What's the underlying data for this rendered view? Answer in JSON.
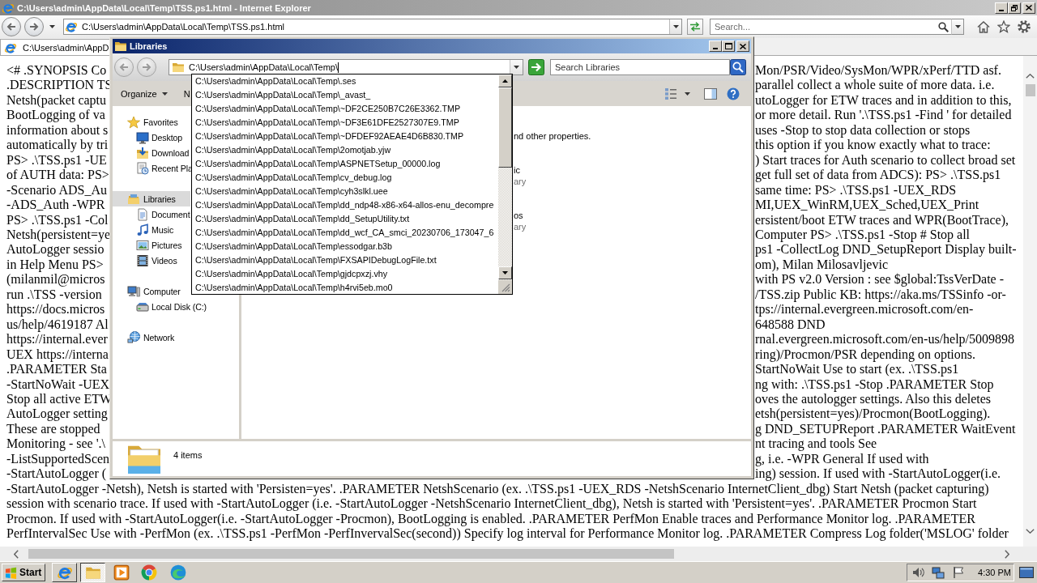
{
  "browser": {
    "title": "C:\\Users\\admin\\AppData\\Local\\Temp\\TSS.ps1.html - Internet Explorer",
    "address": "C:\\Users\\admin\\AppData\\Local\\Temp\\TSS.ps1.html",
    "search": {
      "placeholder": "Search..."
    },
    "tabs": [
      {
        "label": "C:\\Users\\admin\\AppD",
        "selected": true
      }
    ]
  },
  "document": {
    "split_lines": [
      {
        "left": "<# .SYNOPSIS Co",
        "right": "Mon/PSR/Video/SysMon/WPR/xPerf/TTD asf."
      },
      {
        "left": ".DESCRIPTION TS",
        "right": "parallel collect a whole suite of more data. i.e."
      },
      {
        "left": "Netsh(packet captu",
        "right": "utoLogger for ETW traces and in addition to this,"
      },
      {
        "left": "BootLogging of va",
        "right": "or more detail. Run '.\\TSS.ps1 -Find ' for detailed"
      },
      {
        "left": "information about s",
        "right": "uses -Stop to stop data collection or stops"
      },
      {
        "left": "automatically by tri",
        "right": "this option if you know exactly what to trace:"
      },
      {
        "left": "PS> .\\TSS.ps1 -UE",
        "right": ") Start traces for Auth scenario to collect broad set"
      },
      {
        "left": "of AUTH data: PS>",
        "right": "get full set of data from ADCS): PS> .\\TSS.ps1"
      },
      {
        "left": "-Scenario ADS_Au",
        "right": "same time: PS> .\\TSS.ps1 -UEX_RDS"
      },
      {
        "left": "-ADS_Auth -WPR",
        "right": "MI,UEX_WinRM,UEX_Sched,UEX_Print"
      },
      {
        "left": "PS> .\\TSS.ps1 -Col",
        "right": "ersistent/boot ETW traces and WPR(BootTrace),"
      },
      {
        "left": "Netsh(persistent=ye",
        "right": "Computer PS> .\\TSS.ps1 -Stop # Stop all"
      },
      {
        "left": "AutoLogger sessio",
        "right": "ps1 -CollectLog DND_SetupReport Display built-"
      },
      {
        "left": "in Help Menu PS>",
        "right": "om), Milan Milosavljevic"
      },
      {
        "left": "(milanmil@micros",
        "right": "with PS v2.0 Version : see $global:TssVerDate -"
      },
      {
        "left": "run .\\TSS -version",
        "right": "/TSS.zip Public KB: https://aka.ms/TSSinfo -or-"
      },
      {
        "left": "https://docs.micros",
        "right": "tps://internal.evergreen.microsoft.com/en-"
      },
      {
        "left": "us/help/4619187 Al",
        "right": "648588 DND"
      },
      {
        "left": "https://internal.ever",
        "right": "rnal.evergreen.microsoft.com/en-us/help/5009898"
      },
      {
        "left": "UEX https://interna",
        "right": "ring)/Procmon/PSR depending on options."
      },
      {
        "left": ".PARAMETER Sta",
        "right": "StartNoWait Use to start (ex. .\\TSS.ps1"
      },
      {
        "left": "-StartNoWait -UEX",
        "right": "ng with: .\\TSS.ps1 -Stop .PARAMETER Stop"
      },
      {
        "left": "Stop all active ETW",
        "right": "oves the autologger settings. Also this deletes"
      },
      {
        "left": "AutoLogger setting",
        "right": "etsh(persistent=yes)/Procmon(BootLogging)."
      },
      {
        "left": "These are stopped",
        "right": "g DND_SETUPReport .PARAMETER WaitEvent"
      },
      {
        "left": "Monitoring - see '.\\",
        "right": "nt tracing and tools See"
      },
      {
        "left": "-ListSupportedScen",
        "right": "g, i.e. -WPR General If used with"
      },
      {
        "left": "-StartAutoLogger (",
        "right": "ing) session. If used with -StartAutoLogger(i.e."
      }
    ],
    "full_lines": [
      "-StartAutoLogger -Netsh), Netsh is started with 'Persisten=yes'. .PARAMETER NetshScenario (ex. .\\TSS.ps1 -UEX_RDS -NetshScenario InternetClient_dbg) Start Netsh (packet capturing)",
      "session with scenario trace. If used with -StartAutoLogger (i.e. -StartAutoLogger -NetshScenario InternetClient_dbg), Netsh is started with 'Persistent=yes'. .PARAMETER Procmon Start",
      "Procmon. If used with -StartAutoLogger(i.e. -StartAutoLogger -Procmon), BootLogging is enabled. .PARAMETER PerfMon Enable traces and Performance Monitor log. .PARAMETER",
      "PerfIntervalSec Use with -PerfMon (ex. .\\TSS.ps1 -PerfMon -PerfInvervalSec(second)) Specify log interval for Performance Monitor log. .PARAMETER Compress Log folder('MSLOG' folder"
    ]
  },
  "explorer": {
    "title": "Libraries",
    "address": "C:\\Users\\admin\\AppData\\Local\\Temp\\",
    "search": {
      "placeholder": "Search Libraries"
    },
    "toolbar": [
      {
        "label": "Organize",
        "kind": "menu"
      },
      {
        "label": "N",
        "kind": "button"
      }
    ],
    "nav": [
      {
        "label": "Favorites",
        "selected": false,
        "children": [
          {
            "label": "Desktop",
            "selected": false
          },
          {
            "label": "Download",
            "selected": false
          },
          {
            "label": "Recent Pla",
            "selected": false
          }
        ]
      },
      {
        "label": "Libraries",
        "selected": true,
        "children": [
          {
            "label": "Document",
            "selected": false
          },
          {
            "label": "Music",
            "selected": false
          },
          {
            "label": "Pictures",
            "selected": false
          },
          {
            "label": "Videos",
            "selected": false
          }
        ]
      },
      {
        "label": "Computer",
        "selected": false,
        "children": [
          {
            "label": "Local Disk (C:)",
            "selected": false
          }
        ]
      },
      {
        "label": "Network",
        "selected": false
      }
    ],
    "content": [
      {
        "kind": "text",
        "text": "nd other properties."
      },
      {
        "kind": "name",
        "text": "ic"
      },
      {
        "kind": "caption",
        "text": "ary"
      },
      {
        "kind": "name",
        "text": "os"
      },
      {
        "kind": "caption",
        "text": "ary"
      }
    ],
    "details": "4 items",
    "suggestions": [
      {
        "text": "C:\\Users\\admin\\AppData\\Local\\Temp\\.ses",
        "selected": false
      },
      {
        "text": "C:\\Users\\admin\\AppData\\Local\\Temp\\_avast_",
        "selected": false
      },
      {
        "text": "C:\\Users\\admin\\AppData\\Local\\Temp\\~DF2CE250B7C26E3362.TMP",
        "selected": false
      },
      {
        "text": "C:\\Users\\admin\\AppData\\Local\\Temp\\~DF3E61DFE2527307E9.TMP",
        "selected": false
      },
      {
        "text": "C:\\Users\\admin\\AppData\\Local\\Temp\\~DFDEF92AEAE4D6B830.TMP",
        "selected": false
      },
      {
        "text": "C:\\Users\\admin\\AppData\\Local\\Temp\\2omotjab.yjw",
        "selected": false
      },
      {
        "text": "C:\\Users\\admin\\AppData\\Local\\Temp\\ASPNETSetup_00000.log",
        "selected": false
      },
      {
        "text": "C:\\Users\\admin\\AppData\\Local\\Temp\\cv_debug.log",
        "selected": false
      },
      {
        "text": "C:\\Users\\admin\\AppData\\Local\\Temp\\cyh3slkl.uee",
        "selected": false
      },
      {
        "text": "C:\\Users\\admin\\AppData\\Local\\Temp\\dd_ndp48-x86-x64-allos-enu_decompre",
        "selected": false
      },
      {
        "text": "C:\\Users\\admin\\AppData\\Local\\Temp\\dd_SetupUtility.txt",
        "selected": false
      },
      {
        "text": "C:\\Users\\admin\\AppData\\Local\\Temp\\dd_wcf_CA_smci_20230706_173047_6",
        "selected": false
      },
      {
        "text": "C:\\Users\\admin\\AppData\\Local\\Temp\\essodgar.b3b",
        "selected": false
      },
      {
        "text": "C:\\Users\\admin\\AppData\\Local\\Temp\\FXSAPIDebugLogFile.txt",
        "selected": false
      },
      {
        "text": "C:\\Users\\admin\\AppData\\Local\\Temp\\gjdcpxzj.vhy",
        "selected": false
      },
      {
        "text": "C:\\Users\\admin\\AppData\\Local\\Temp\\h4rvi5eb.mo0",
        "selected": false
      }
    ]
  },
  "taskbar": {
    "start": "Start",
    "apps": [
      {
        "open": true,
        "selected": false
      },
      {
        "open": true,
        "selected": true
      },
      {
        "open": false,
        "selected": false
      },
      {
        "open": false,
        "selected": false
      },
      {
        "open": false,
        "selected": false
      }
    ],
    "clock": "4:30 PM"
  }
}
